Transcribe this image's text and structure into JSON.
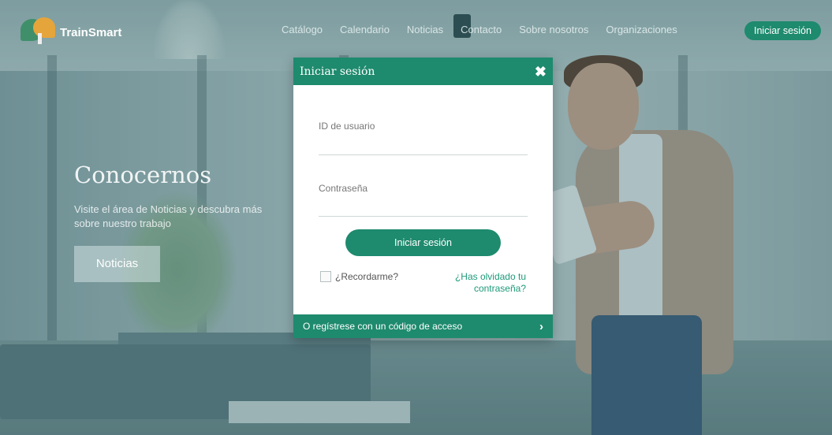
{
  "header": {
    "logo_text": "TrainSmart",
    "nav": [
      "Catálogo",
      "Calendario",
      "Noticias",
      "Contacto",
      "Sobre nosotros",
      "Organizaciones"
    ],
    "login_button": "Iniciar sesión"
  },
  "hero": {
    "title": "Conocernos",
    "text": "Visite el área de Noticias y descubra más sobre nuestro trabajo",
    "button": "Noticias"
  },
  "modal": {
    "title": "Iniciar sesión",
    "username_placeholder": "ID de usuario",
    "password_placeholder": "Contraseña",
    "submit": "Iniciar sesión",
    "remember": "¿Recordarme?",
    "forgot": "¿Has olvidado tu contraseña?",
    "footer": "O regístrese con un código de acceso"
  },
  "colors": {
    "accent": "#1e8a6e",
    "link": "#1e9a7a"
  }
}
